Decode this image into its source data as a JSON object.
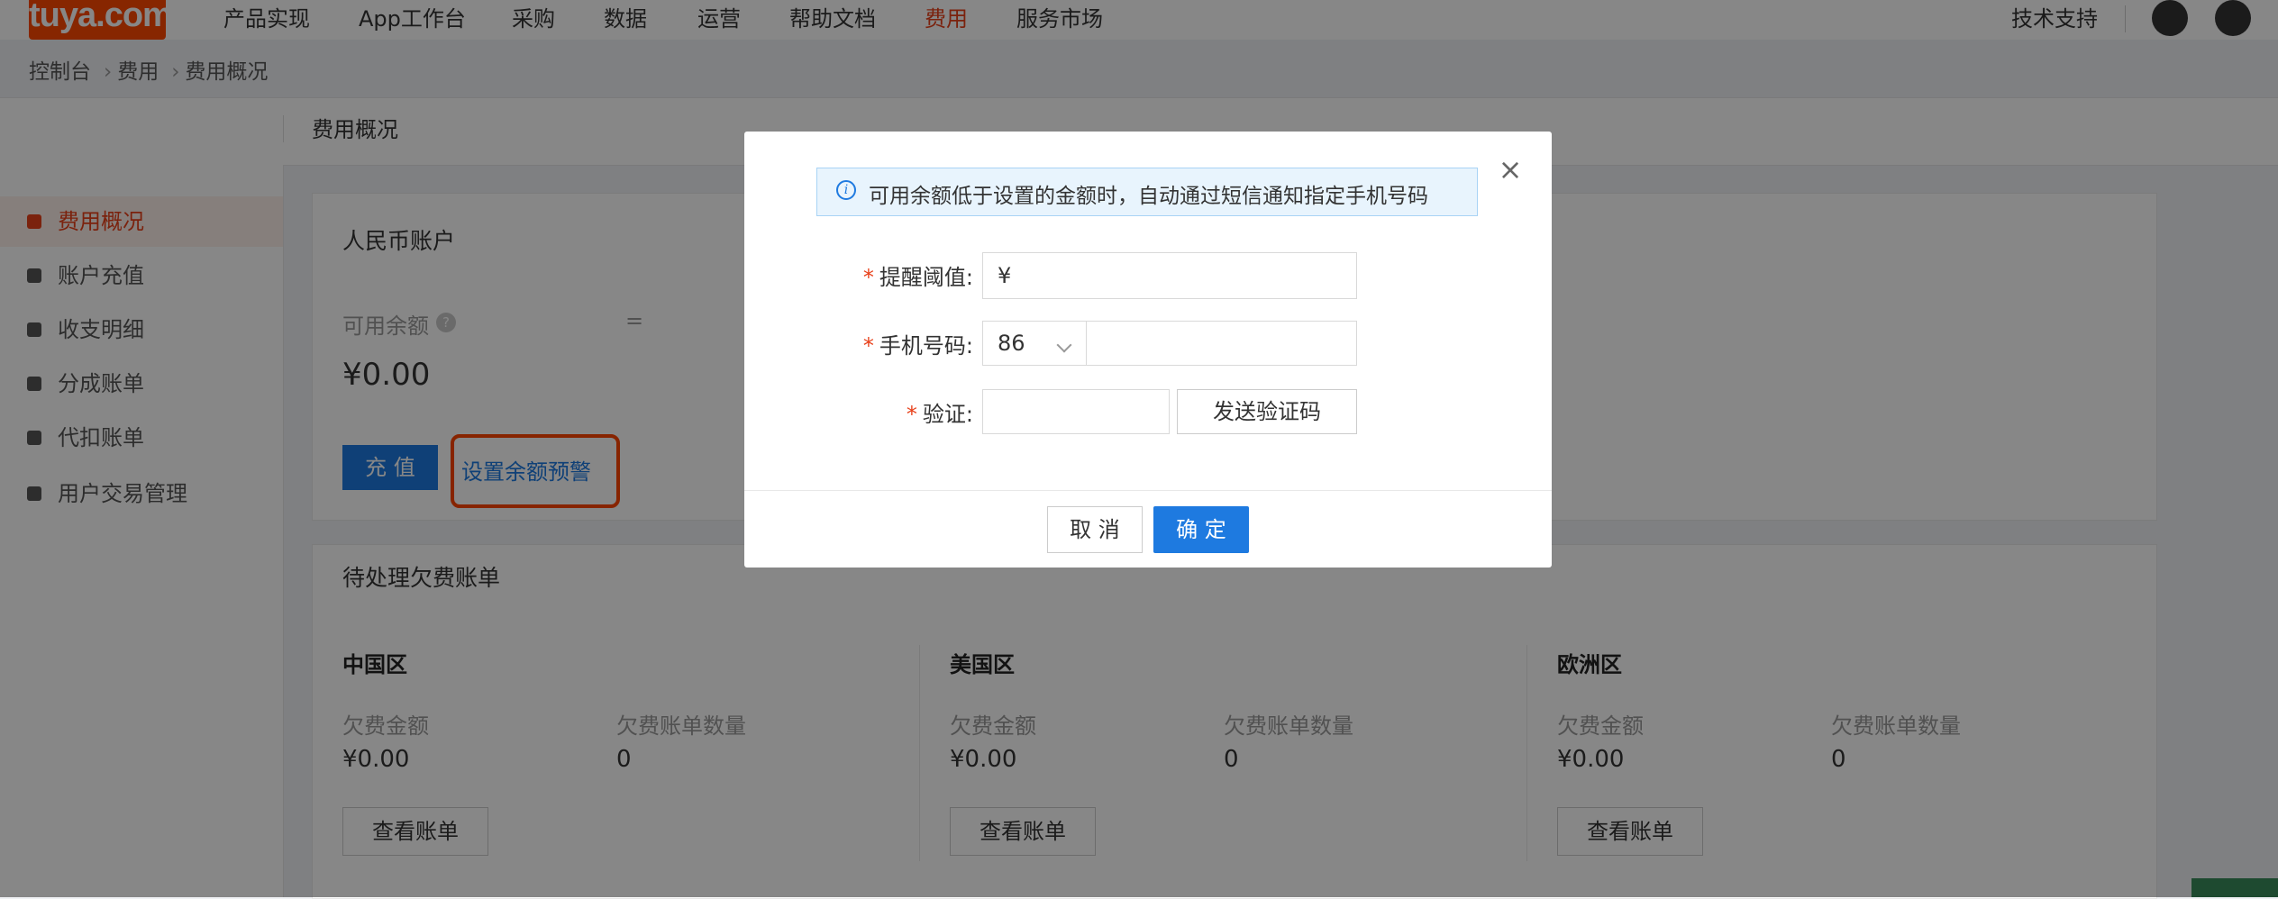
{
  "topnav": {
    "logo": "tuya.com",
    "items": [
      "产品实现",
      "App工作台",
      "采购",
      "数据",
      "运营",
      "帮助文档",
      "费用",
      "服务市场"
    ],
    "active_index": 6,
    "support": "技术支持"
  },
  "breadcrumb": [
    "控制台",
    "费用",
    "费用概况"
  ],
  "subheader_title": "费用概况",
  "sidebar": {
    "items": [
      "费用概况",
      "账户充值",
      "收支明细",
      "分成账单",
      "代扣账单",
      "用户交易管理"
    ],
    "active_index": 0
  },
  "account_card": {
    "title": "人民币账户",
    "available_label": "可用余额",
    "help_icon": "?",
    "equals": "=",
    "balance": "¥0.00",
    "recharge_button": "充 值",
    "alert_link": "设置余额预警"
  },
  "arrears_card": {
    "title": "待处理欠费账单",
    "regions": [
      {
        "name": "中国区",
        "amount_label": "欠费金额",
        "count_label": "欠费账单数量",
        "amount": "¥0.00",
        "count": "0",
        "button": "查看账单"
      },
      {
        "name": "美国区",
        "amount_label": "欠费金额",
        "count_label": "欠费账单数量",
        "amount": "¥0.00",
        "count": "0",
        "button": "查看账单"
      },
      {
        "name": "欧洲区",
        "amount_label": "欠费金额",
        "count_label": "欠费账单数量",
        "amount": "¥0.00",
        "count": "0",
        "button": "查看账单"
      }
    ]
  },
  "modal": {
    "close": "×",
    "info": "可用余额低于设置的金额时，自动通过短信通知指定手机号码",
    "info_icon": "i",
    "threshold_label": "提醒阈值:",
    "threshold_prefix": "¥",
    "threshold_value": "",
    "phone_label": "手机号码:",
    "country_code": "86",
    "phone_value": "",
    "verify_label": "验证:",
    "verify_value": "",
    "send_code_button": "发送验证码",
    "cancel_button": "取 消",
    "confirm_button": "确 定",
    "required_mark": "*"
  },
  "colors": {
    "brand": "#ff4800",
    "primary": "#1e7ae0",
    "highlight_box": "#ff4500",
    "active_nav": "#e8401a"
  }
}
